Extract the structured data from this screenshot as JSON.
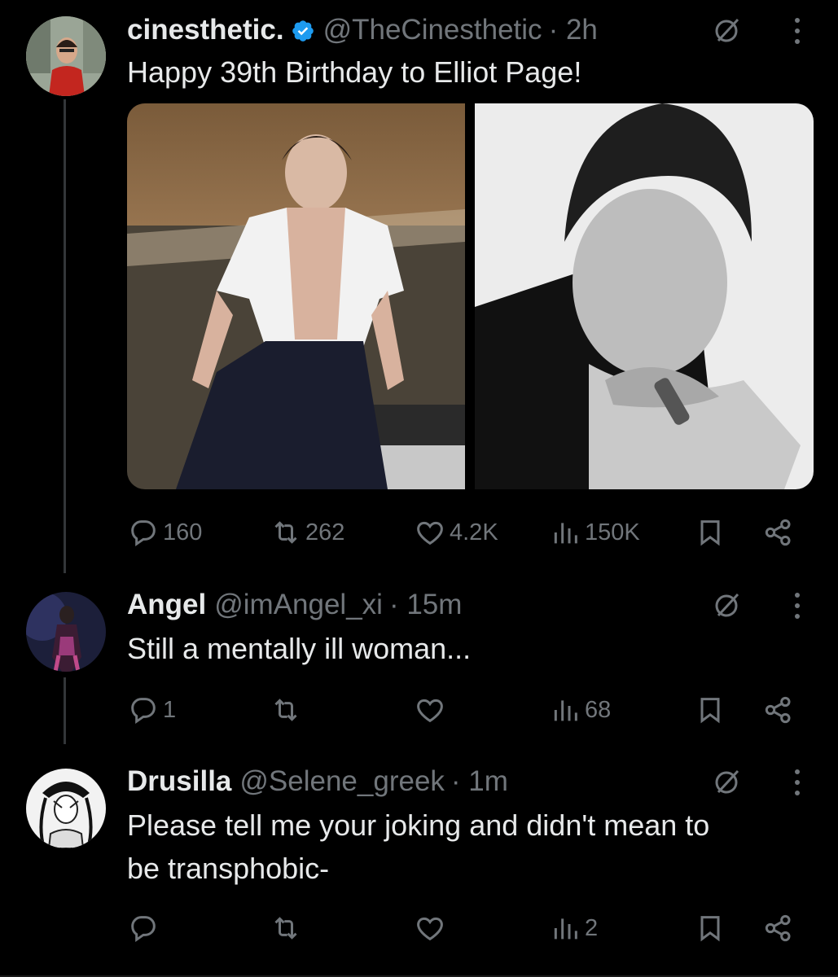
{
  "tweets": [
    {
      "name": "cinesthetic.",
      "handle": "@TheCinesthetic",
      "time": "· 2h",
      "verified": true,
      "text": "Happy 39th Birthday to Elliot Page!",
      "media_count": 2,
      "stats": {
        "replies": "160",
        "reposts": "262",
        "likes": "4.2K",
        "views": "150K"
      }
    },
    {
      "name": "Angel",
      "handle": "@imAngel_xi",
      "time": "· 15m",
      "text": "Still a mentally ill woman...",
      "stats": {
        "replies": "1",
        "reposts": "",
        "likes": "",
        "views": "68"
      }
    },
    {
      "name": "Drusilla",
      "handle": "@Selene_greek",
      "time": "· 1m",
      "text_line1": "Please tell me your joking and didn't mean to",
      "text_line2": "be transphobic-",
      "stats": {
        "replies": "",
        "reposts": "",
        "likes": "",
        "views": "2"
      }
    }
  ],
  "icons": {
    "reply": "reply-icon",
    "repost": "repost-icon",
    "like": "heart-icon",
    "views": "views-icon",
    "bookmark": "bookmark-icon",
    "share": "share-icon",
    "grok": "grok-icon",
    "more": "more-icon",
    "verified": "verified-badge-icon"
  },
  "colors": {
    "background": "#000000",
    "text": "#e7e9ea",
    "muted": "#71767b",
    "verified": "#1d9bf0"
  }
}
